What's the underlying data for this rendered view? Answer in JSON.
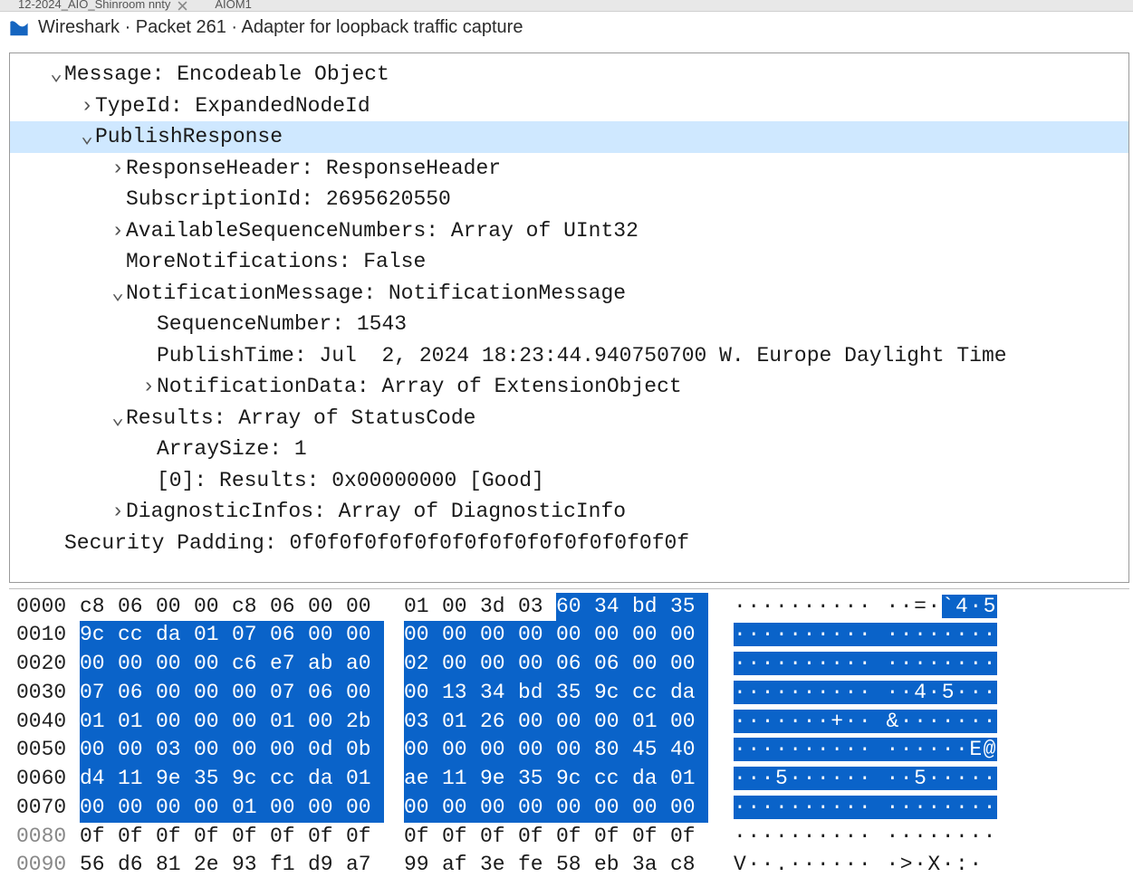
{
  "tabs_hint": [
    "12-2024_AIO_Shinroom nnty",
    "AIOM1"
  ],
  "window_title": "Wireshark · Packet 261 · Adapter for loopback traffic capture",
  "tree": [
    {
      "indent": 1,
      "exp": "v",
      "text": "Message: Encodeable Object",
      "interact": true
    },
    {
      "indent": 2,
      "exp": ">",
      "text": "TypeId: ExpandedNodeId",
      "interact": true
    },
    {
      "indent": 2,
      "exp": "v",
      "text": "PublishResponse",
      "selected": true,
      "interact": true
    },
    {
      "indent": 3,
      "exp": ">",
      "text": "ResponseHeader: ResponseHeader",
      "interact": true
    },
    {
      "indent": 3,
      "exp": "",
      "text": "SubscriptionId: 2695620550",
      "interact": true
    },
    {
      "indent": 3,
      "exp": ">",
      "text": "AvailableSequenceNumbers: Array of UInt32",
      "interact": true
    },
    {
      "indent": 3,
      "exp": "",
      "text": "MoreNotifications: False",
      "interact": true
    },
    {
      "indent": 3,
      "exp": "v",
      "text": "NotificationMessage: NotificationMessage",
      "interact": true
    },
    {
      "indent": 4,
      "exp": "",
      "text": "SequenceNumber: 1543",
      "interact": true
    },
    {
      "indent": 4,
      "exp": "",
      "text": "PublishTime: Jul  2, 2024 18:23:44.940750700 W. Europe Daylight Time",
      "interact": true
    },
    {
      "indent": 4,
      "exp": ">",
      "text": "NotificationData: Array of ExtensionObject",
      "interact": true
    },
    {
      "indent": 3,
      "exp": "v",
      "text": "Results: Array of StatusCode",
      "interact": true
    },
    {
      "indent": 4,
      "exp": "",
      "text": "ArraySize: 1",
      "interact": true
    },
    {
      "indent": 4,
      "exp": "",
      "text": "[0]: Results: 0x00000000 [Good]",
      "interact": true
    },
    {
      "indent": 3,
      "exp": ">",
      "text": "DiagnosticInfos: Array of DiagnosticInfo",
      "interact": true
    },
    {
      "indent": 1,
      "exp": "",
      "text": "Security Padding: 0f0f0f0f0f0f0f0f0f0f0f0f0f0f0f0f",
      "interact": true
    }
  ],
  "hex": {
    "rows": [
      {
        "offset": "0000",
        "off_on": true,
        "bytes": [
          "c8",
          "06",
          "00",
          "00",
          "c8",
          "06",
          "00",
          "00",
          "01",
          "00",
          "3d",
          "03",
          "60",
          "34",
          "bd",
          "35"
        ],
        "sel": [
          0,
          0,
          0,
          0,
          0,
          0,
          0,
          0,
          0,
          0,
          0,
          0,
          1,
          1,
          1,
          1
        ],
        "ascii": "·········· ··=·`4·5",
        "asc_sel": [
          0,
          0,
          0,
          0,
          0,
          0,
          0,
          0,
          0,
          0,
          0,
          0,
          0,
          0,
          0,
          1,
          1,
          1,
          1
        ]
      },
      {
        "offset": "0010",
        "off_on": true,
        "bytes": [
          "9c",
          "cc",
          "da",
          "01",
          "07",
          "06",
          "00",
          "00",
          "00",
          "00",
          "00",
          "00",
          "00",
          "00",
          "00",
          "00"
        ],
        "sel": [
          1,
          1,
          1,
          1,
          1,
          1,
          1,
          1,
          1,
          1,
          1,
          1,
          1,
          1,
          1,
          1
        ],
        "ascii": "·········· ········",
        "asc_sel": [
          1,
          1,
          1,
          1,
          1,
          1,
          1,
          1,
          1,
          1,
          1,
          1,
          1,
          1,
          1,
          1,
          1,
          1,
          1
        ]
      },
      {
        "offset": "0020",
        "off_on": true,
        "bytes": [
          "00",
          "00",
          "00",
          "00",
          "c6",
          "e7",
          "ab",
          "a0",
          "02",
          "00",
          "00",
          "00",
          "06",
          "06",
          "00",
          "00"
        ],
        "sel": [
          1,
          1,
          1,
          1,
          1,
          1,
          1,
          1,
          1,
          1,
          1,
          1,
          1,
          1,
          1,
          1
        ],
        "ascii": "·········· ········",
        "asc_sel": [
          1,
          1,
          1,
          1,
          1,
          1,
          1,
          1,
          1,
          1,
          1,
          1,
          1,
          1,
          1,
          1,
          1,
          1,
          1
        ]
      },
      {
        "offset": "0030",
        "off_on": true,
        "bytes": [
          "07",
          "06",
          "00",
          "00",
          "00",
          "07",
          "06",
          "00",
          "00",
          "13",
          "34",
          "bd",
          "35",
          "9c",
          "cc",
          "da"
        ],
        "sel": [
          1,
          1,
          1,
          1,
          1,
          1,
          1,
          1,
          1,
          1,
          1,
          1,
          1,
          1,
          1,
          1
        ],
        "ascii": "·········· ··4·5···",
        "asc_sel": [
          1,
          1,
          1,
          1,
          1,
          1,
          1,
          1,
          1,
          1,
          1,
          1,
          1,
          1,
          1,
          1,
          1,
          1,
          1
        ]
      },
      {
        "offset": "0040",
        "off_on": true,
        "bytes": [
          "01",
          "01",
          "00",
          "00",
          "00",
          "01",
          "00",
          "2b",
          "03",
          "01",
          "26",
          "00",
          "00",
          "00",
          "01",
          "00"
        ],
        "sel": [
          1,
          1,
          1,
          1,
          1,
          1,
          1,
          1,
          1,
          1,
          1,
          1,
          1,
          1,
          1,
          1
        ],
        "ascii": "·······+·· &·······",
        "asc_sel": [
          1,
          1,
          1,
          1,
          1,
          1,
          1,
          1,
          1,
          1,
          1,
          1,
          1,
          1,
          1,
          1,
          1,
          1,
          1
        ]
      },
      {
        "offset": "0050",
        "off_on": true,
        "bytes": [
          "00",
          "00",
          "03",
          "00",
          "00",
          "00",
          "0d",
          "0b",
          "00",
          "00",
          "00",
          "00",
          "00",
          "80",
          "45",
          "40"
        ],
        "sel": [
          1,
          1,
          1,
          1,
          1,
          1,
          1,
          1,
          1,
          1,
          1,
          1,
          1,
          1,
          1,
          1
        ],
        "ascii": "·········· ······E@",
        "asc_sel": [
          1,
          1,
          1,
          1,
          1,
          1,
          1,
          1,
          1,
          1,
          1,
          1,
          1,
          1,
          1,
          1,
          1,
          1,
          1
        ]
      },
      {
        "offset": "0060",
        "off_on": true,
        "bytes": [
          "d4",
          "11",
          "9e",
          "35",
          "9c",
          "cc",
          "da",
          "01",
          "ae",
          "11",
          "9e",
          "35",
          "9c",
          "cc",
          "da",
          "01"
        ],
        "sel": [
          1,
          1,
          1,
          1,
          1,
          1,
          1,
          1,
          1,
          1,
          1,
          1,
          1,
          1,
          1,
          1
        ],
        "ascii": "···5······ ··5·····",
        "asc_sel": [
          1,
          1,
          1,
          1,
          1,
          1,
          1,
          1,
          1,
          1,
          1,
          1,
          1,
          1,
          1,
          1,
          1,
          1,
          1
        ]
      },
      {
        "offset": "0070",
        "off_on": true,
        "bytes": [
          "00",
          "00",
          "00",
          "00",
          "01",
          "00",
          "00",
          "00",
          "00",
          "00",
          "00",
          "00",
          "00",
          "00",
          "00",
          "00"
        ],
        "sel": [
          1,
          1,
          1,
          1,
          1,
          1,
          1,
          1,
          1,
          1,
          1,
          1,
          1,
          1,
          1,
          1
        ],
        "ascii": "·········· ········",
        "asc_sel": [
          1,
          1,
          1,
          1,
          1,
          1,
          1,
          1,
          1,
          1,
          1,
          1,
          1,
          1,
          1,
          1,
          1,
          1,
          1
        ]
      },
      {
        "offset": "0080",
        "off_on": false,
        "bytes": [
          "0f",
          "0f",
          "0f",
          "0f",
          "0f",
          "0f",
          "0f",
          "0f",
          "0f",
          "0f",
          "0f",
          "0f",
          "0f",
          "0f",
          "0f",
          "0f"
        ],
        "sel": [
          0,
          0,
          0,
          0,
          0,
          0,
          0,
          0,
          0,
          0,
          0,
          0,
          0,
          0,
          0,
          0
        ],
        "ascii": "·········· ········",
        "asc_sel": [
          0,
          0,
          0,
          0,
          0,
          0,
          0,
          0,
          0,
          0,
          0,
          0,
          0,
          0,
          0,
          0,
          0,
          0,
          0
        ]
      },
      {
        "offset": "0090",
        "off_on": false,
        "bytes": [
          "56",
          "d6",
          "81",
          "2e",
          "93",
          "f1",
          "d9",
          "a7",
          "99",
          "af",
          "3e",
          "fe",
          "58",
          "eb",
          "3a",
          "c8"
        ],
        "sel": [
          0,
          0,
          0,
          0,
          0,
          0,
          0,
          0,
          0,
          0,
          0,
          0,
          0,
          0,
          0,
          0
        ],
        "ascii": "V··.······ ·>·X·:·",
        "asc_sel": [
          0,
          0,
          0,
          0,
          0,
          0,
          0,
          0,
          0,
          0,
          0,
          0,
          0,
          0,
          0,
          0,
          0,
          0
        ]
      }
    ]
  }
}
